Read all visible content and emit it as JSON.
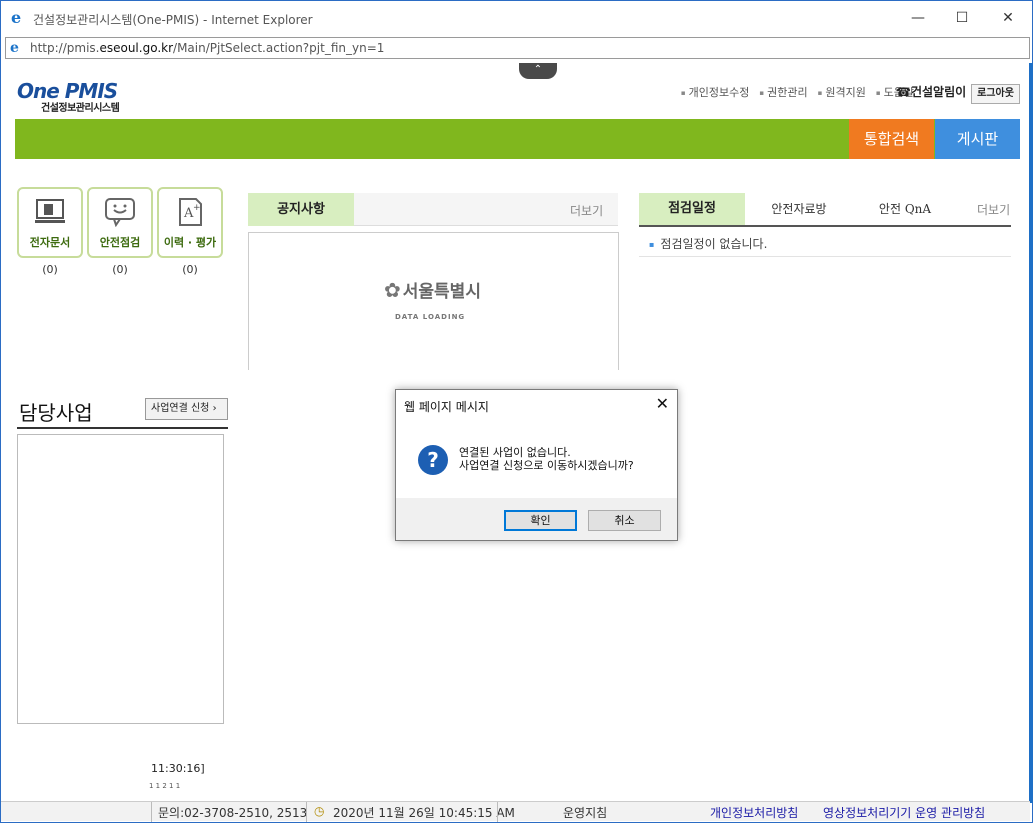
{
  "window": {
    "title": "건설정보관리시스템(One-PMIS) - Internet Explorer",
    "url_prefix": "http://pmis.",
    "url_domain": "eseoul.go.kr",
    "url_path": "/Main/PjtSelect.action?pjt_fin_yn=1"
  },
  "header": {
    "logo_main": "One PMIS",
    "logo_sub": "건설정보관리시스템",
    "nav": [
      "개인정보수정",
      "권한관리",
      "원격지원",
      "도움말"
    ],
    "alarm": "건설알림이",
    "logout": "로그아웃",
    "search_btn": "통합검색",
    "board_btn": "게시판"
  },
  "quick_icons": [
    {
      "label": "전자문서",
      "count": "(0)",
      "icon": "monitor-document-icon"
    },
    {
      "label": "안전점검",
      "count": "(0)",
      "icon": "speech-bubble-icon"
    },
    {
      "label": "이력 · 평가",
      "count": "(0)",
      "icon": "grade-document-icon"
    }
  ],
  "notice": {
    "tab": "공지사항",
    "more": "더보기",
    "logo_text": "서울특별시",
    "loading": "DATA LOADING"
  },
  "schedule": {
    "tabs": [
      "점검일정",
      "안전자료방",
      "안전 QnA"
    ],
    "more": "더보기",
    "empty": "점검일정이 없습니다."
  },
  "projects": {
    "title": "담당사업",
    "connect_btn": "사업연결 신청",
    "fragment_time": "11:30:16]",
    "fragment_small": "1 1 2 1 1"
  },
  "statusbar": {
    "contact": "문의:02-3708-2510, 2513",
    "datetime": "2020년 11월 26일 10:45:15 AM",
    "policy": "운영지침",
    "privacy": "개인정보처리방침",
    "cctv": "영상정보처리기기 운영 관리방침"
  },
  "dialog": {
    "title": "웹 페이지 메시지",
    "line1": "연결된 사업이 없습니다.",
    "line2": "사업연결 신청으로 이동하시겠습니까?",
    "ok": "확인",
    "cancel": "취소"
  },
  "colors": {
    "green": "#80b71e",
    "orange": "#f07a20",
    "blue": "#3f8fde"
  }
}
